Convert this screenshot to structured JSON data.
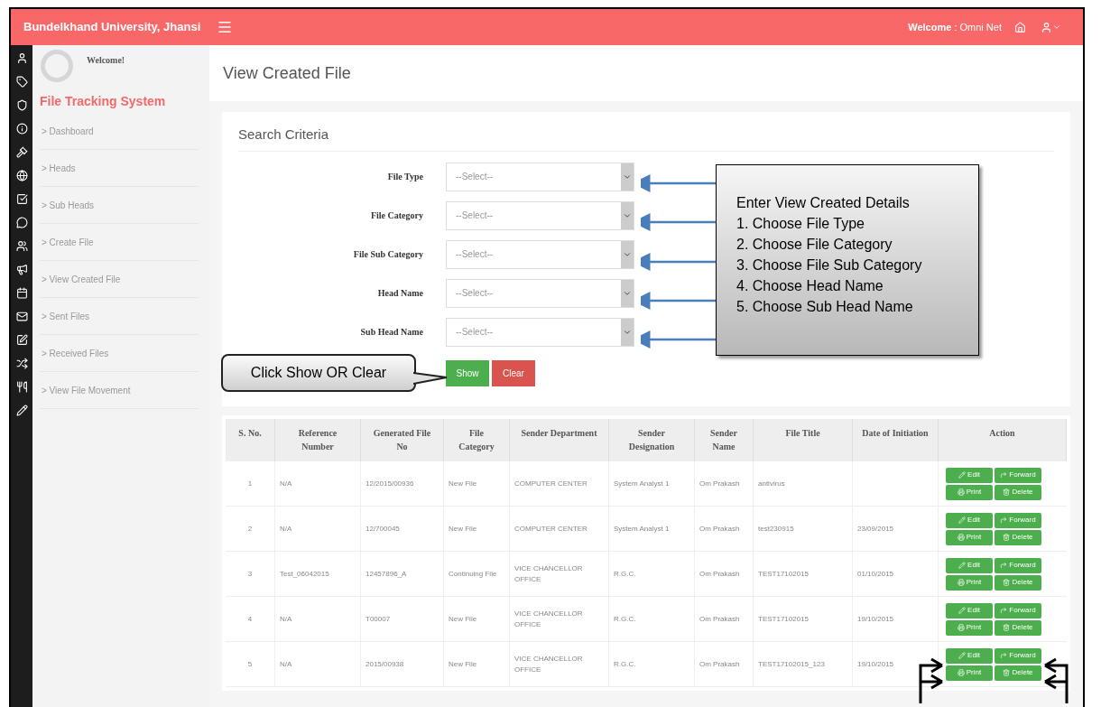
{
  "header": {
    "brand": "Bundelkhand University, Jhansi",
    "welcome_label": "Welcome",
    "welcome_user": ": Omni Net"
  },
  "sidebar": {
    "greeting": "Welcome!",
    "system_title": "File Tracking System",
    "items": [
      {
        "label": "> Dashboard",
        "selected": false
      },
      {
        "label": "> Heads",
        "selected": false
      },
      {
        "label": "> Sub Heads",
        "selected": false
      },
      {
        "label": "> Create File",
        "selected": false
      },
      {
        "label": "> View Created File",
        "selected": false
      },
      {
        "label": "> Sent Files",
        "selected": false
      },
      {
        "label": "> Received Files",
        "selected": false
      },
      {
        "label": "> View File Movement",
        "selected": false
      }
    ]
  },
  "page_title": "View Created File",
  "search": {
    "title": "Search Criteria",
    "fields": [
      {
        "label": "File Type",
        "placeholder": "--Select--"
      },
      {
        "label": "File Category",
        "placeholder": "--Select--"
      },
      {
        "label": "File Sub Category",
        "placeholder": "--Select--"
      },
      {
        "label": "Head Name",
        "placeholder": "--Select--"
      },
      {
        "label": "Sub Head Name",
        "placeholder": "--Select--"
      }
    ],
    "buttons": [
      {
        "label": "Show",
        "kind": "primary"
      },
      {
        "label": "Clear",
        "kind": "danger"
      }
    ]
  },
  "table": {
    "columns": [
      "S. No.",
      "Reference Number",
      "Generated File No",
      "File Category",
      "Sender Department",
      "Sender Designation",
      "Sender Name",
      "File Title",
      "Date of Initiation",
      "Action"
    ],
    "rows": [
      {
        "cells": [
          "1",
          "N/A",
          "12/2015/00936",
          "New File",
          "COMPUTER CENTER",
          "System Analyst 1",
          "Om Prakash",
          "antivirus",
          ""
        ],
        "actions": [
          {
            "label": "Edit",
            "kind": "edit"
          },
          {
            "label": "Forward",
            "kind": "forward"
          },
          {
            "label": "Print",
            "kind": "print"
          },
          {
            "label": "Delete",
            "kind": "delete"
          }
        ]
      },
      {
        "cells": [
          "2",
          "N/A",
          "12/700045",
          "New File",
          "COMPUTER CENTER",
          "System Analyst 1",
          "Om Prakash",
          "test230915",
          "23/09/2015"
        ],
        "actions": [
          {
            "label": "Edit",
            "kind": "edit"
          },
          {
            "label": "Forward",
            "kind": "forward"
          },
          {
            "label": "Print",
            "kind": "print"
          },
          {
            "label": "Delete",
            "kind": "delete"
          }
        ]
      },
      {
        "cells": [
          "3",
          "Test_06042015",
          "12457896_A",
          "Continuing File",
          "VICE CHANCELLOR OFFICE",
          "R.G.C.",
          "Om Prakash",
          "TEST17102015",
          "01/10/2015"
        ],
        "actions": [
          {
            "label": "Edit",
            "kind": "edit"
          },
          {
            "label": "Forward",
            "kind": "forward"
          },
          {
            "label": "Print",
            "kind": "print"
          },
          {
            "label": "Delete",
            "kind": "delete"
          }
        ]
      },
      {
        "cells": [
          "4",
          "N/A",
          "T00007",
          "New File",
          "VICE CHANCELLOR OFFICE",
          "R.G.C.",
          "Om Prakash",
          "TEST17102015",
          "19/10/2015"
        ],
        "actions": [
          {
            "label": "Edit",
            "kind": "edit"
          },
          {
            "label": "Forward",
            "kind": "forward"
          },
          {
            "label": "Print",
            "kind": "print"
          },
          {
            "label": "Delete",
            "kind": "delete"
          }
        ]
      },
      {
        "cells": [
          "5",
          "N/A",
          "2015/00938",
          "New File",
          "VICE CHANCELLOR OFFICE",
          "R.G.C.",
          "Om Prakash",
          "TEST17102015_123",
          "19/10/2015"
        ],
        "actions": [
          {
            "label": "Edit",
            "kind": "edit"
          },
          {
            "label": "Forward",
            "kind": "forward"
          },
          {
            "label": "Print",
            "kind": "print"
          },
          {
            "label": "Delete",
            "kind": "delete"
          }
        ]
      }
    ]
  },
  "annotations": {
    "fields_note": {
      "title": "Enter View Created Details",
      "steps": [
        "1. Choose File Type",
        "2. Choose File Category",
        "3. Choose File Sub Category",
        "4. Choose Head Name",
        "5. Choose Sub Head Name"
      ]
    },
    "buttons_note": "Click Show OR Clear"
  }
}
